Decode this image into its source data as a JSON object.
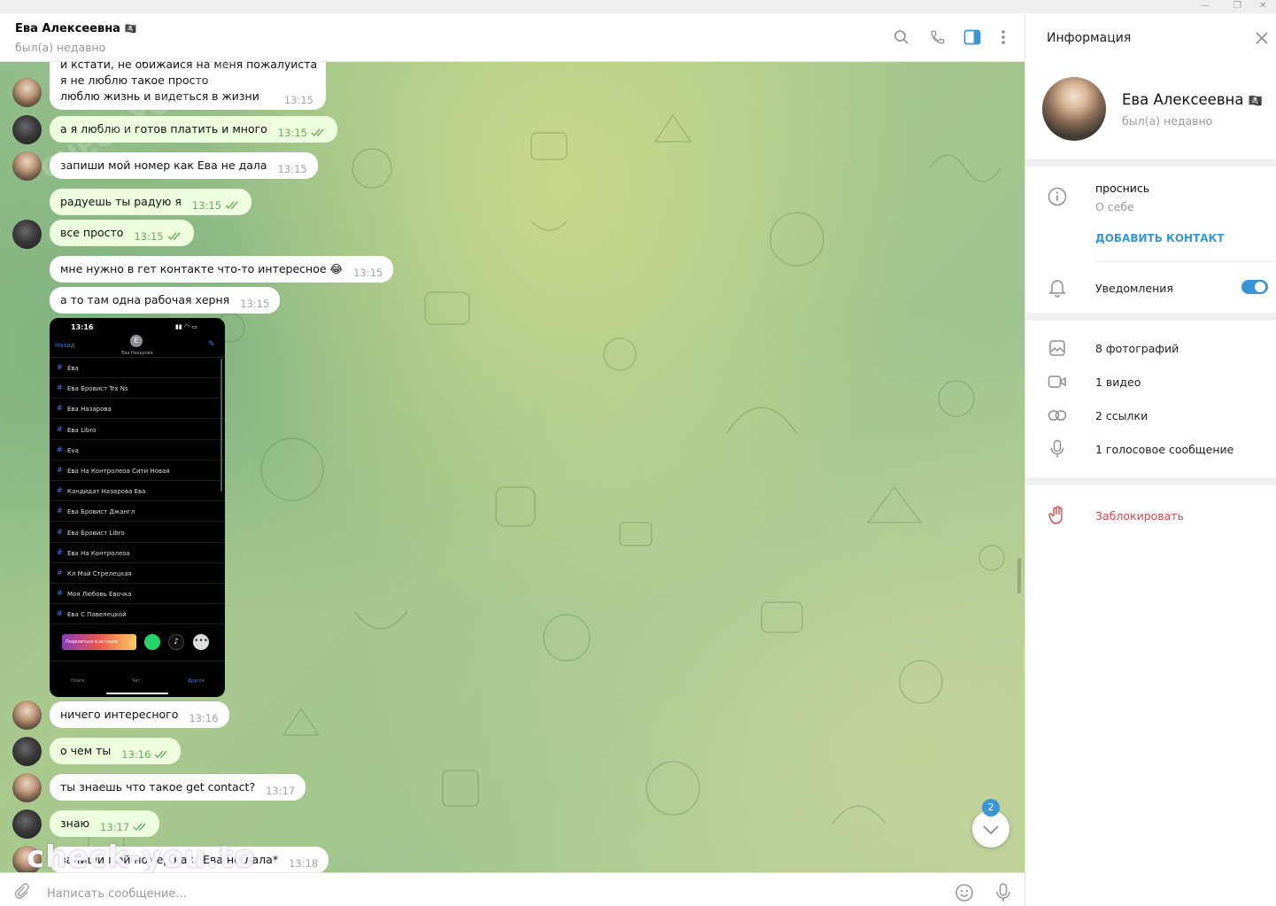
{
  "window": {
    "min": "—",
    "restore": "❐",
    "close": "✕"
  },
  "chat": {
    "name": "Ева Алексеевна",
    "status": "был(а) недавно",
    "input_placeholder": "Написать сообщение...",
    "unread_count": "2"
  },
  "messages": [
    {
      "from": "her",
      "lines": [
        "и кстати, не обижайся на меня пожалуйста",
        "я не люблю такое просто",
        "люблю жизнь и видеться в жизни"
      ],
      "time": "13:15"
    },
    {
      "from": "me",
      "text": "а я люблю и готов платить и много",
      "time": "13:15",
      "read": true
    },
    {
      "from": "her",
      "text": "запиши мой номер как Ева не дала",
      "time": "13:15"
    },
    {
      "from": "me",
      "text": "радуешь ты радую я",
      "time": "13:15",
      "read": true
    },
    {
      "from": "me",
      "text": "все просто",
      "time": "13:15",
      "read": true
    },
    {
      "from": "her",
      "text": "мне нужно в гет контакте что-то интересное 😂",
      "time": "13:15"
    },
    {
      "from": "her",
      "text": "а то там одна рабочая херня",
      "time": "13:15"
    },
    {
      "from": "her",
      "text": "ничего интересного",
      "time": "13:16"
    },
    {
      "from": "me",
      "text": "о чем ты",
      "time": "13:16",
      "read": true
    },
    {
      "from": "her",
      "text": "ты знаешь что такое get contact?",
      "time": "13:17"
    },
    {
      "from": "me",
      "text": "знаю",
      "time": "13:17",
      "read": true
    },
    {
      "from": "her",
      "text": "запиши мой номер как *Ева не дала*",
      "time": "13:18"
    }
  ],
  "screenshot": {
    "clock": "13:16",
    "back": "Назад",
    "avatar_letter": "E",
    "contact": "Ева Назарова",
    "tags": [
      "Ева",
      "Ева Бровист Trx Ns",
      "Ева Назарова",
      "Ева Libro",
      "Eva",
      "Ева На Контролеоа Сити Новая",
      "Кандидат Назарова Ева",
      "Ева Бровист Джангл",
      "Ева Бровист Libro",
      "Ева На Контролеоа",
      "Кл Май Стрелецкая",
      "Моя Любовь Евочка",
      "Ева С Павелецкой"
    ],
    "share": "Поделиться в истории",
    "tabs": [
      "Поиск",
      "Чат",
      "Другое"
    ]
  },
  "panel": {
    "title": "Информация",
    "name": "Ева Алексеевна",
    "status": "был(а) недавно",
    "bio": "проснись",
    "bio_label": "О себе",
    "add_contact": "ДОБАВИТЬ КОНТАКТ",
    "notifications": "Уведомления",
    "notifications_on": true,
    "media": {
      "photos": "8 фотографий",
      "videos": "1 видео",
      "links": "2 ссылки",
      "voice": "1 голосовое сообщение"
    },
    "block": "Заблокировать"
  },
  "watermarks": {
    "bottom": "check-you.to",
    "corner": "CHECK-YOU.ME"
  },
  "colors": {
    "accent": "#3a95d6",
    "outgoing_bubble": "#eeffde",
    "incoming_bubble": "#ffffff",
    "danger": "#d14b4b",
    "read_check": "#6aae5d"
  }
}
